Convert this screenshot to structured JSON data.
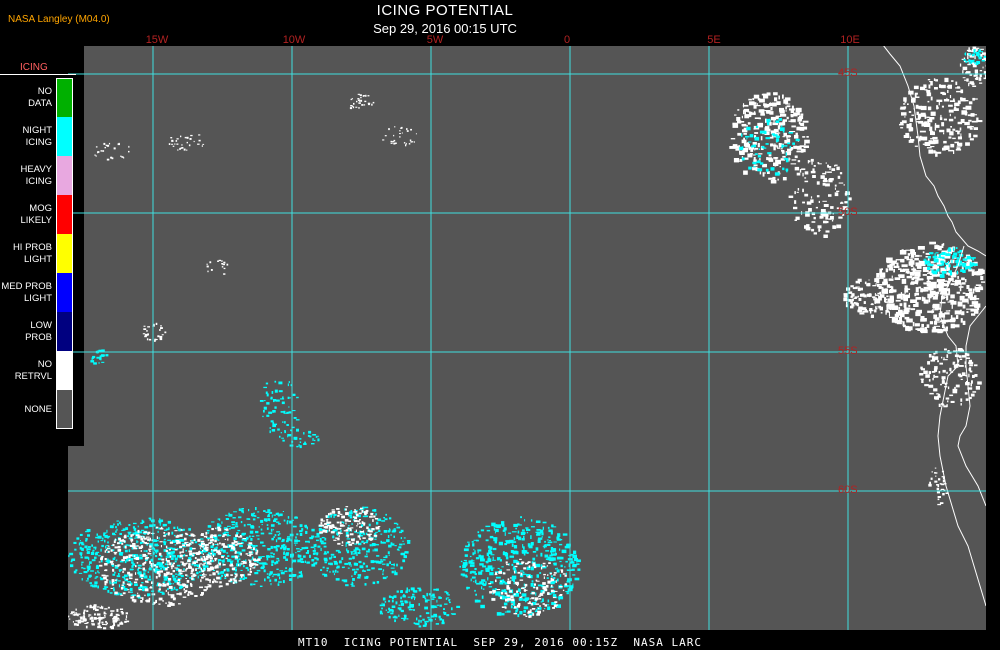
{
  "header": {
    "producer": "NASA Langley (M04.0)",
    "title": "ICING POTENTIAL",
    "subtitle": "Sep 29, 2016 00:15 UTC"
  },
  "map": {
    "longitude_labels": [
      "15W",
      "10W",
      "5W",
      "0",
      "5E",
      "10E"
    ],
    "latitude_labels": [
      "45S",
      "50S",
      "55S",
      "60S"
    ],
    "colors": {
      "background": "#555555",
      "grid": "#40e0e0",
      "coast": "#ffffff",
      "night_icing": "#00ffff",
      "no_retrieval": "#ffffff"
    }
  },
  "legend": {
    "heading": "ICING",
    "entries": [
      {
        "label": "NO DATA",
        "color": "#00b000"
      },
      {
        "label": "NIGHT ICING",
        "color": "#00ffff"
      },
      {
        "label": "HEAVY ICING",
        "color": "#e8a8e0"
      },
      {
        "label": "MOG LIKELY",
        "color": "#ff0000"
      },
      {
        "label": "HI PROB LIGHT",
        "color": "#ffff00"
      },
      {
        "label": "MED PROB LIGHT",
        "color": "#0000ff"
      },
      {
        "label": "LOW PROB",
        "color": "#000080"
      },
      {
        "label": "NO RETRVL",
        "color": "#ffffff"
      },
      {
        "label": "NONE",
        "color": "#555555"
      }
    ]
  },
  "footer": {
    "caption": "MT10  ICING POTENTIAL  SEP 29, 2016 00:15Z  NASA LARC"
  }
}
